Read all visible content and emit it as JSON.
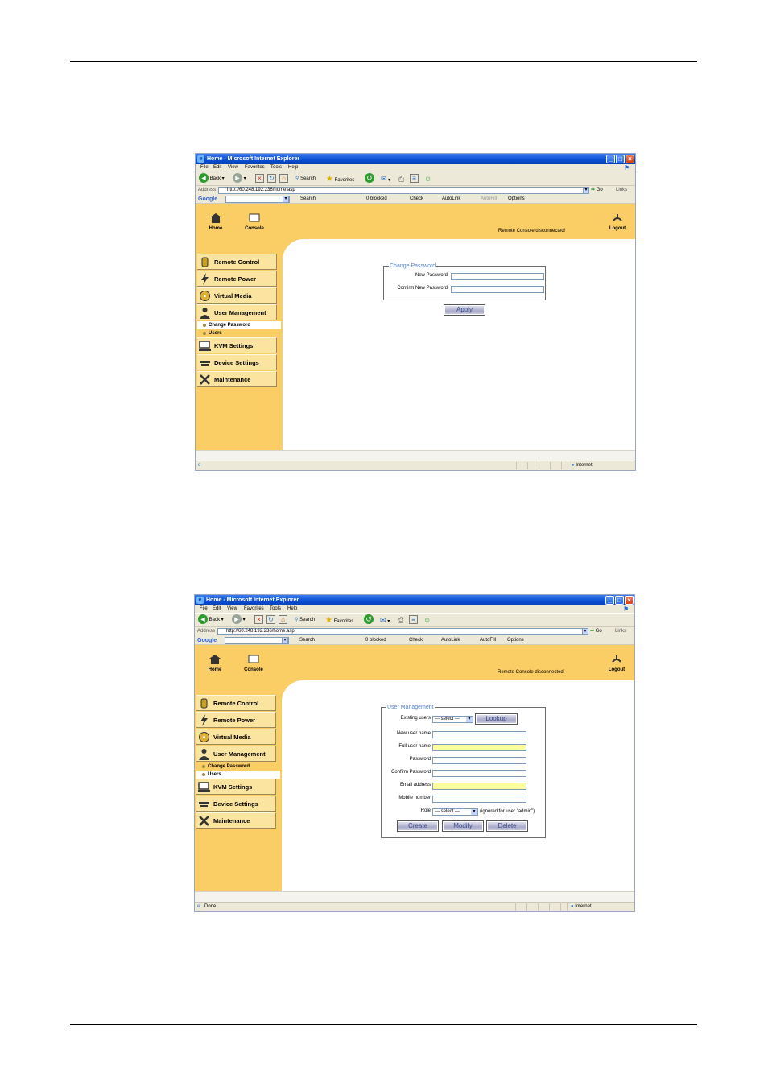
{
  "shots": [
    {
      "window_title": "Home - Microsoft Internet Explorer",
      "menu": [
        "File",
        "Edit",
        "View",
        "Favorites",
        "Tools",
        "Help"
      ],
      "toolbar": {
        "back": "Back",
        "search": "Search",
        "favorites": "Favorites"
      },
      "address": {
        "label": "Address",
        "url": "http://60.248.192.236/home.asp",
        "go": "Go",
        "links": "Links"
      },
      "google_bar": {
        "logo": "Google",
        "search": "Search",
        "blocked": "0 blocked",
        "check": "Check",
        "autolink": "AutoLink",
        "autofill": "AutoFill",
        "options": "Options"
      },
      "top_nav": {
        "home": "Home",
        "console": "Console",
        "status": "Remote Console disconnected!",
        "logout": "Logout"
      },
      "sidebar": [
        "Remote Control",
        "Remote Power",
        "Virtual Media",
        "User Management",
        "KVM Settings",
        "Device Settings",
        "Maintenance"
      ],
      "sub_items": [
        "Change Password",
        "Users"
      ],
      "form": {
        "legend": "Change Password",
        "fields": [
          "New Password",
          "Confirm New Password"
        ],
        "apply": "Apply"
      },
      "status_left": "",
      "status_zone": "Internet"
    },
    {
      "window_title": "Home - Microsoft Internet Explorer",
      "menu": [
        "File",
        "Edit",
        "View",
        "Favorites",
        "Tools",
        "Help"
      ],
      "toolbar": {
        "back": "Back",
        "search": "Search",
        "favorites": "Favorites"
      },
      "address": {
        "label": "Address",
        "url": "http://60.248.192.236/home.asp",
        "go": "Go",
        "links": "Links"
      },
      "google_bar": {
        "logo": "Google",
        "search": "Search",
        "blocked": "0 blocked",
        "check": "Check",
        "autolink": "AutoLink",
        "autofill": "AutoFill",
        "options": "Options"
      },
      "top_nav": {
        "home": "Home",
        "console": "Console",
        "status": "Remote Console disconnected!",
        "logout": "Logout"
      },
      "sidebar": [
        "Remote Control",
        "Remote Power",
        "Virtual Media",
        "User Management",
        "KVM Settings",
        "Device Settings",
        "Maintenance"
      ],
      "sub_items": [
        "Change Password",
        "Users"
      ],
      "form": {
        "legend": "User Management",
        "existing_label": "Existing users",
        "select_placeholder": "--- select ---",
        "lookup": "Lookup",
        "fields": [
          "New user name",
          "Full user name",
          "Password",
          "Confirm Password",
          "Email address",
          "Mobile number"
        ],
        "role_label": "Role",
        "role_note": "(ignored for user \"admin\")",
        "create": "Create",
        "modify": "Modify",
        "delete": "Delete"
      },
      "status_left": "Done",
      "status_zone": "Internet"
    }
  ],
  "colors": {
    "page_bg": "#fbcd65",
    "nav_item": "#fbe4a0",
    "legend": "#5a83c6",
    "required_field": "#ffff9c",
    "titlebar": "#0a4fd4"
  }
}
